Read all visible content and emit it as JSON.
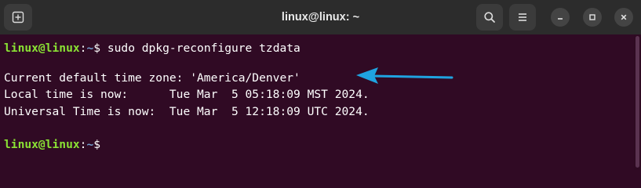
{
  "window": {
    "title": "linux@linux: ~"
  },
  "icons": {
    "new_tab": "new-tab-icon",
    "search": "search-icon",
    "menu": "hamburger-menu-icon",
    "minimize": "minimize-icon",
    "maximize": "maximize-icon",
    "close": "close-icon",
    "annotation": "arrow-icon"
  },
  "prompt": {
    "user": "linux@linux",
    "colon": ":",
    "path": "~",
    "symbol": "$"
  },
  "terminal": {
    "command": " sudo dpkg-reconfigure tzdata",
    "output": [
      "Current default time zone: 'America/Denver'",
      "Local time is now:      Tue Mar  5 05:18:09 MST 2024.",
      "Universal Time is now:  Tue Mar  5 12:18:09 UTC 2024."
    ]
  },
  "colors": {
    "terminal_bg": "#300a24",
    "prompt_user": "#8ae234",
    "prompt_path": "#729fcf",
    "arrow": "#1fa3e0"
  }
}
